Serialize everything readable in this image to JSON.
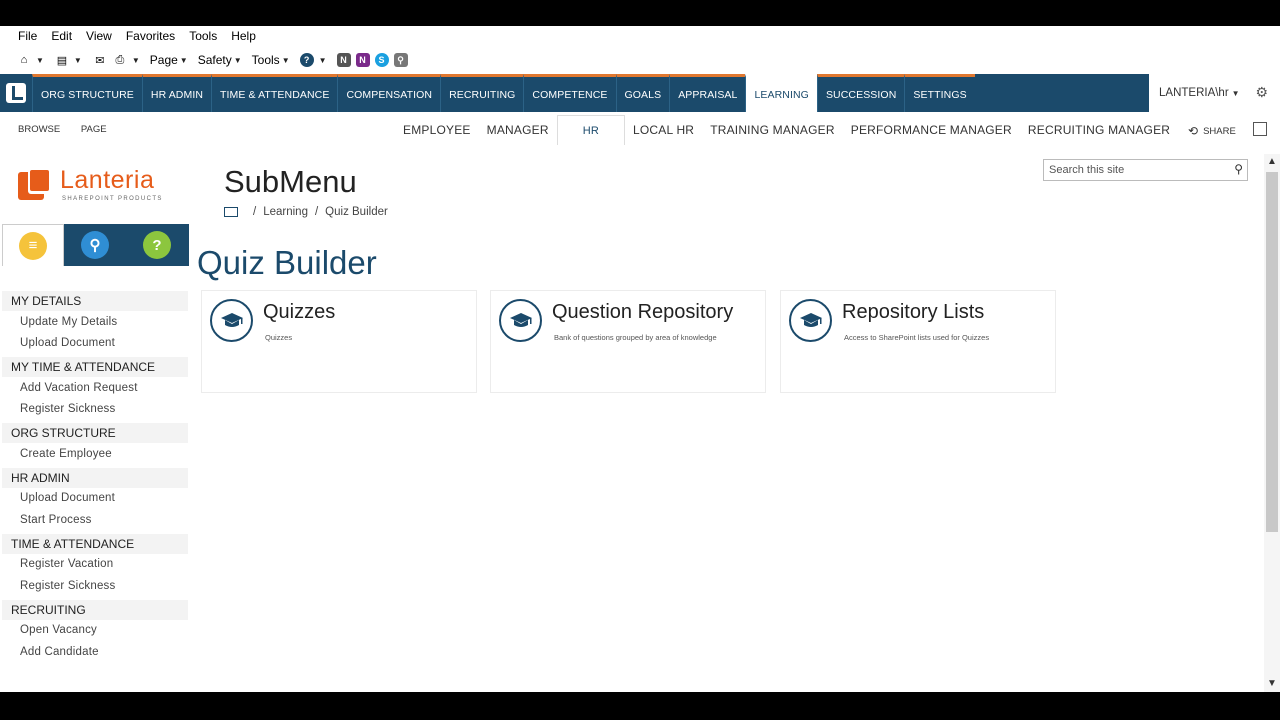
{
  "ie": {
    "menu": [
      "File",
      "Edit",
      "View",
      "Favorites",
      "Tools",
      "Help"
    ],
    "commands": {
      "page": "Page",
      "safety": "Safety",
      "tools": "Tools"
    }
  },
  "nav": {
    "tabs": [
      "ORG STRUCTURE",
      "HR ADMIN",
      "TIME & ATTENDANCE",
      "COMPENSATION",
      "RECRUITING",
      "COMPETENCE",
      "GOALS",
      "APPRAISAL",
      "LEARNING",
      "SUCCESSION",
      "SETTINGS"
    ],
    "active": "LEARNING",
    "user": "LANTERIA\\hr",
    "brand_color": "#1b4a6b",
    "accent_color": "#e07830"
  },
  "ribbon": {
    "browse": "BROWSE",
    "page": "PAGE",
    "subnav": [
      "EMPLOYEE",
      "MANAGER",
      "HR",
      "LOCAL HR",
      "TRAINING MANAGER",
      "PERFORMANCE MANAGER",
      "RECRUITING MANAGER"
    ],
    "active": "HR",
    "share": "SHARE"
  },
  "logo": {
    "name": "Lanteria",
    "tagline": "SHAREPOINT PRODUCTS"
  },
  "page": {
    "title": "SubMenu",
    "breadcrumb": [
      "Learning",
      "Quiz Builder"
    ],
    "section_title": "Quiz Builder",
    "search_placeholder": "Search this site"
  },
  "sidebar": {
    "groups": [
      {
        "title": "MY DETAILS",
        "items": [
          "Update My Details",
          "Upload Document"
        ]
      },
      {
        "title": "MY TIME & ATTENDANCE",
        "items": [
          "Add Vacation Request",
          "Register Sickness"
        ]
      },
      {
        "title": "ORG STRUCTURE",
        "items": [
          "Create Employee"
        ]
      },
      {
        "title": "HR ADMIN",
        "items": [
          "Upload Document",
          "Start Process"
        ]
      },
      {
        "title": "TIME & ATTENDANCE",
        "items": [
          "Register Vacation",
          "Register Sickness"
        ]
      },
      {
        "title": "RECRUITING",
        "items": [
          "Open Vacancy",
          "Add Candidate"
        ]
      }
    ]
  },
  "tiles": [
    {
      "title": "Quizzes",
      "desc": "Quizzes"
    },
    {
      "title": "Question Repository",
      "desc": "Bank of questions grouped by area of knowledge"
    },
    {
      "title": "Repository Lists",
      "desc": "Access to SharePoint lists used for Quizzes"
    }
  ]
}
